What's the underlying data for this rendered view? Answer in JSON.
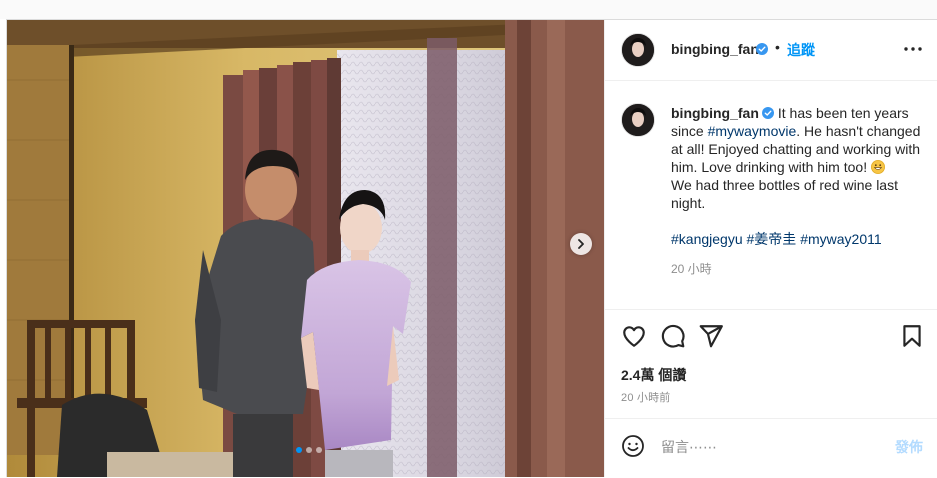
{
  "author": {
    "username": "bingbing_fan",
    "verified": true,
    "follow_label": "追蹤",
    "separator": "•"
  },
  "caption": {
    "text_part1": "It has been ten years since ",
    "mention": "#mywaymovie",
    "text_part2": ". He hasn't changed at all! Enjoyed chatting and working with him. Love drinking with him too! ",
    "emoji": "grinning-face-emoji",
    "text_part3": "We had three bottles of red wine last night.",
    "hashtags": [
      "#kangjegyu",
      "#姜帝圭",
      "#myway2011"
    ],
    "time": "20 小時"
  },
  "stats": {
    "likes": "2.4萬 個讚",
    "posted": "20 小時前"
  },
  "comment": {
    "placeholder": "留言⋯⋯",
    "post_label": "發佈"
  },
  "carousel": {
    "slide_count": 3,
    "current": 1
  },
  "icons": [
    "more-icon",
    "verified-badge-icon",
    "heart-icon",
    "comment-icon",
    "share-icon",
    "bookmark-icon",
    "emoji-icon",
    "chevron-right-icon"
  ],
  "colors": {
    "accent": "#0095f6",
    "hashtag": "#00376b",
    "muted": "#8e8e8e"
  }
}
